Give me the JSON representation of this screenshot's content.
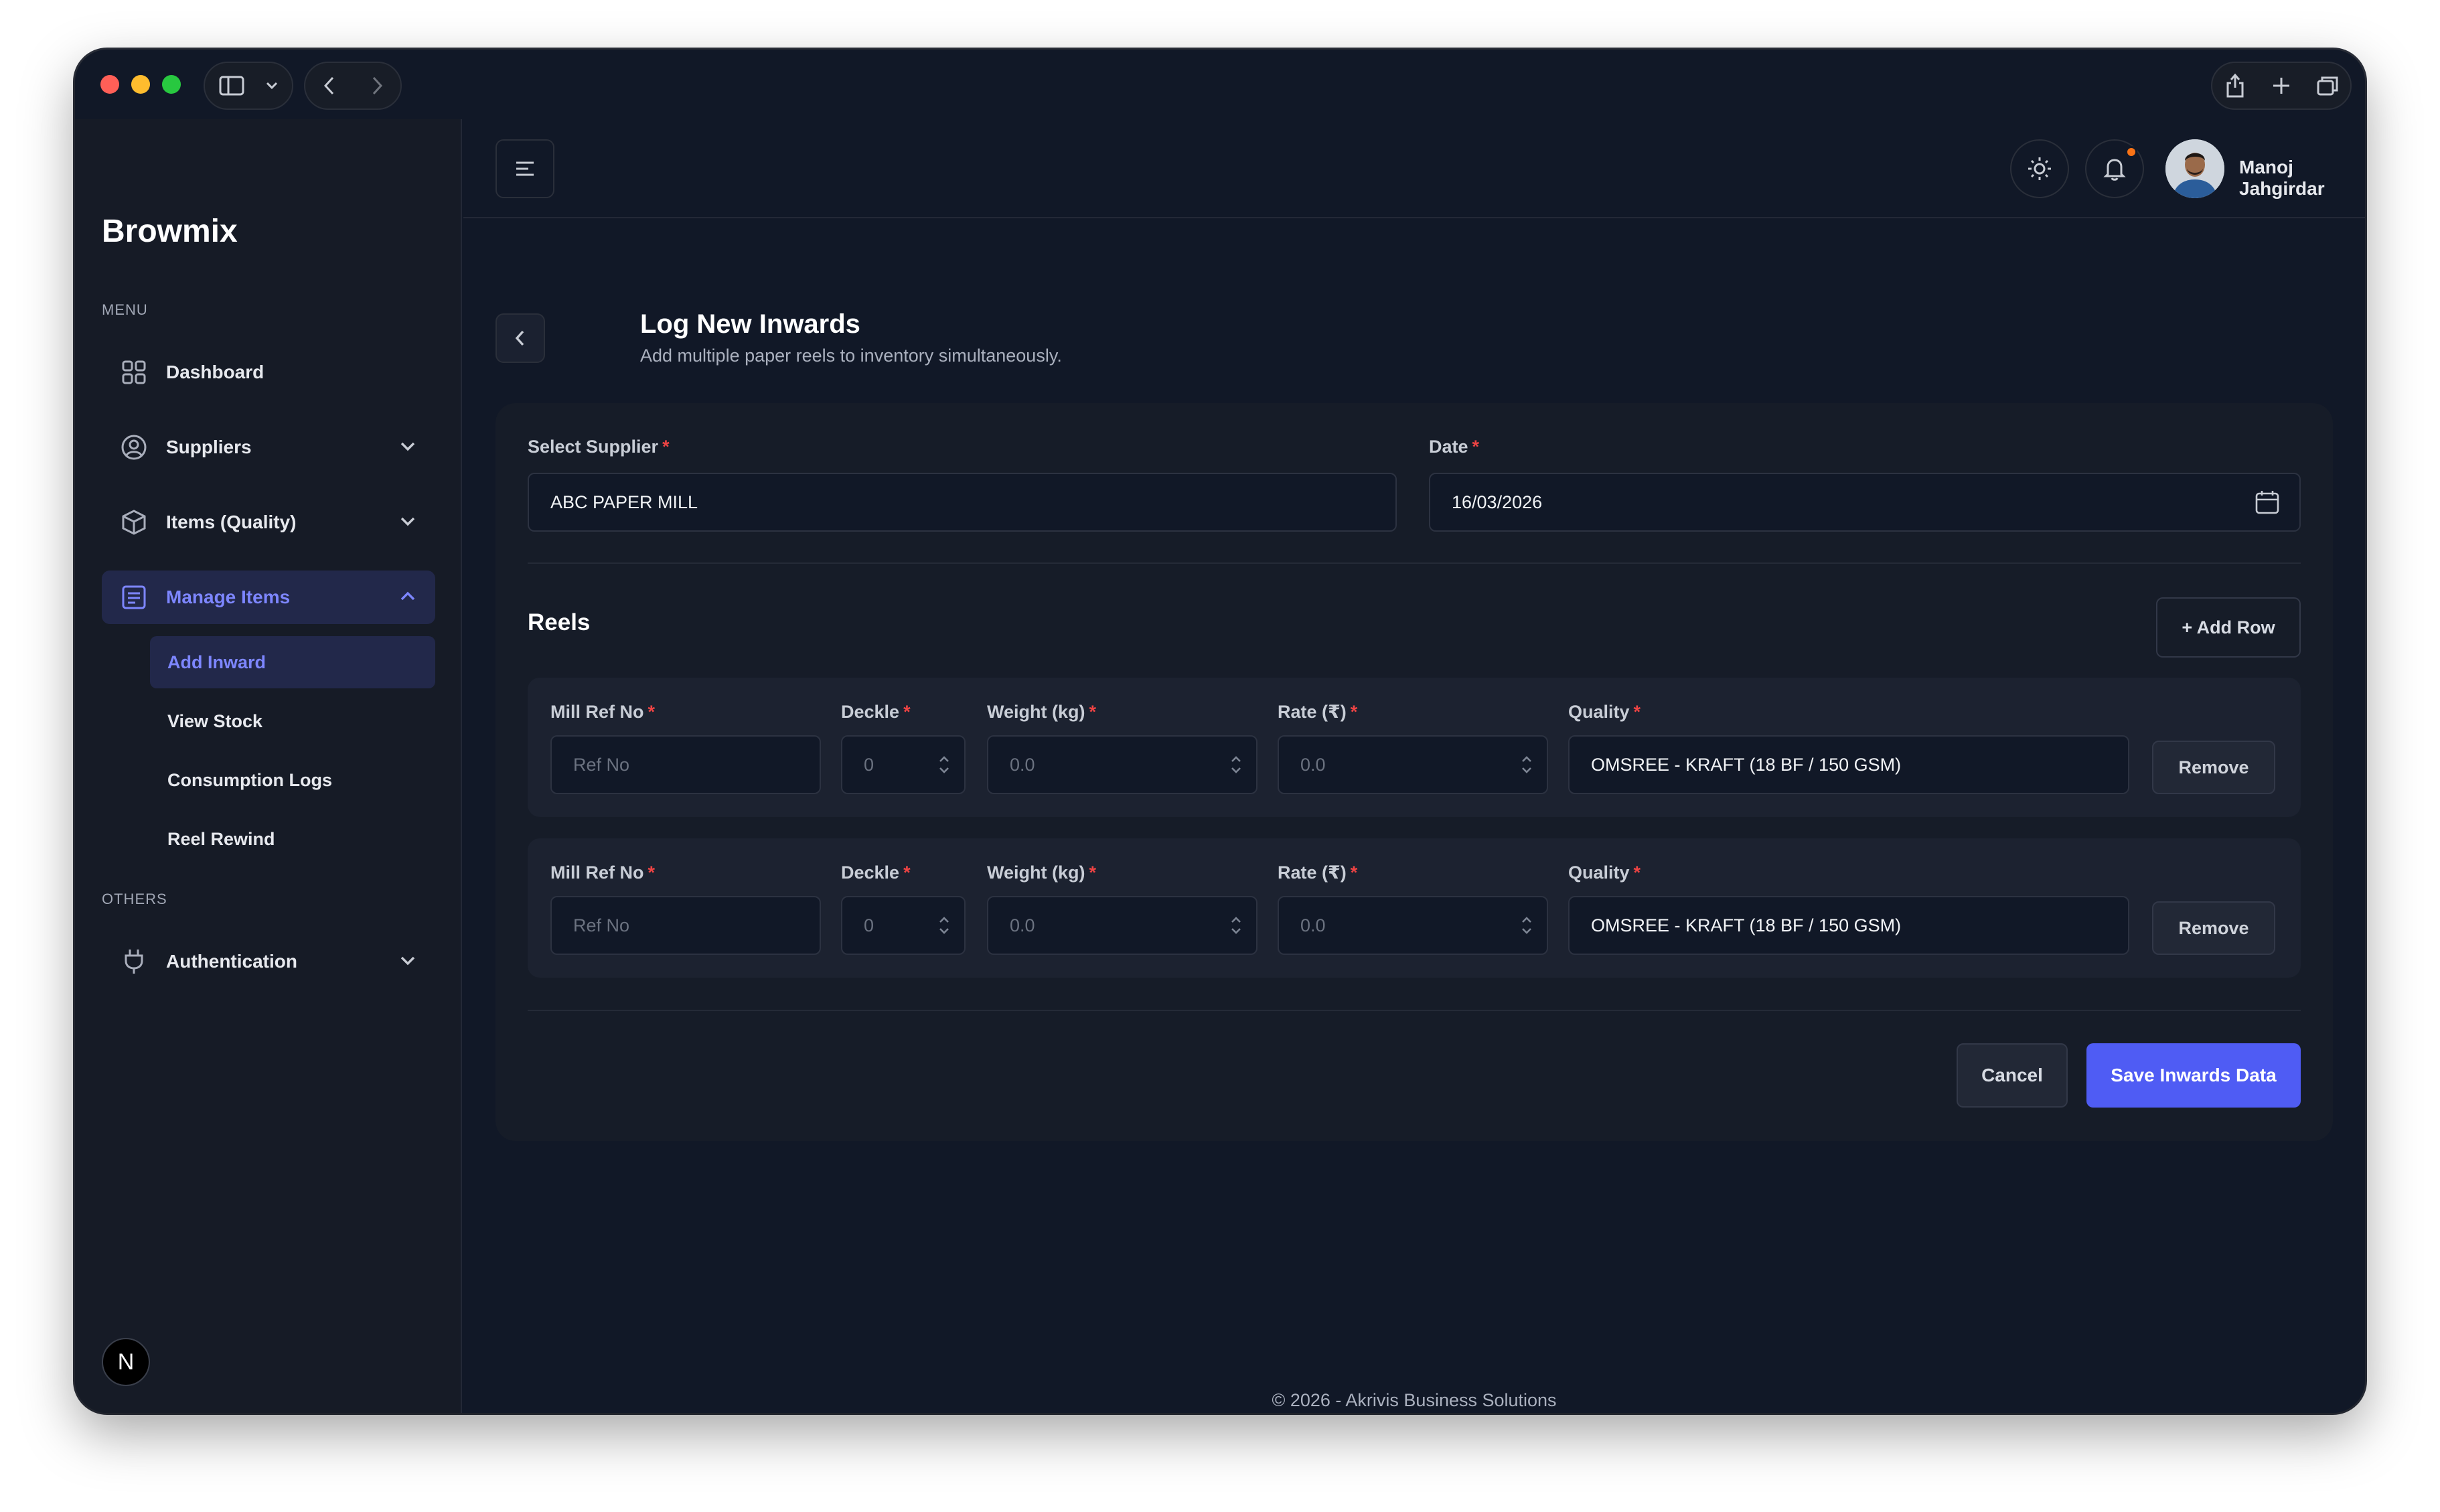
{
  "sidebar": {
    "brand": "Browmix",
    "menu_label": "MENU",
    "others_label": "OTHERS",
    "items": {
      "dashboard": "Dashboard",
      "suppliers": "Suppliers",
      "items_quality": "Items (Quality)",
      "manage_items": "Manage Items",
      "authentication": "Authentication"
    },
    "sub_items": {
      "add_inward": "Add Inward",
      "view_stock": "View Stock",
      "consumption_logs": "Consumption Logs",
      "reel_rewind": "Reel Rewind"
    },
    "badge": "N"
  },
  "header": {
    "user_name": "Manoj Jahgirdar",
    "has_notification": true
  },
  "page": {
    "title": "Log New Inwards",
    "subtitle": "Add multiple paper reels to inventory simultaneously."
  },
  "form": {
    "supplier_label": "Select Supplier",
    "supplier_value": "ABC PAPER MILL",
    "date_label": "Date",
    "date_value": "16/03/2026",
    "required_mark": "*",
    "reels_title": "Reels",
    "add_row_label": "+ Add Row",
    "columns": {
      "mill_ref": "Mill Ref No",
      "deckle": "Deckle",
      "weight": "Weight (kg)",
      "rate": "Rate (₹)",
      "quality": "Quality"
    },
    "reels": [
      {
        "mill_ref_placeholder": "Ref No",
        "deckle_placeholder": "0",
        "weight_placeholder": "0.0",
        "rate_placeholder": "0.0",
        "quality": "OMSREE - KRAFT (18 BF / 150 GSM)",
        "remove_label": "Remove"
      },
      {
        "mill_ref_placeholder": "Ref No",
        "deckle_placeholder": "0",
        "weight_placeholder": "0.0",
        "rate_placeholder": "0.0",
        "quality": "OMSREE - KRAFT (18 BF / 150 GSM)",
        "remove_label": "Remove"
      }
    ],
    "cancel_label": "Cancel",
    "save_label": "Save Inwards Data"
  },
  "footer": {
    "text": "© 2026 - Akrivis Business Solutions"
  },
  "colors": {
    "accent": "#4f5cf4",
    "active_nav": "#7d86ff",
    "required": "#ef4444",
    "notification": "#f97316"
  }
}
